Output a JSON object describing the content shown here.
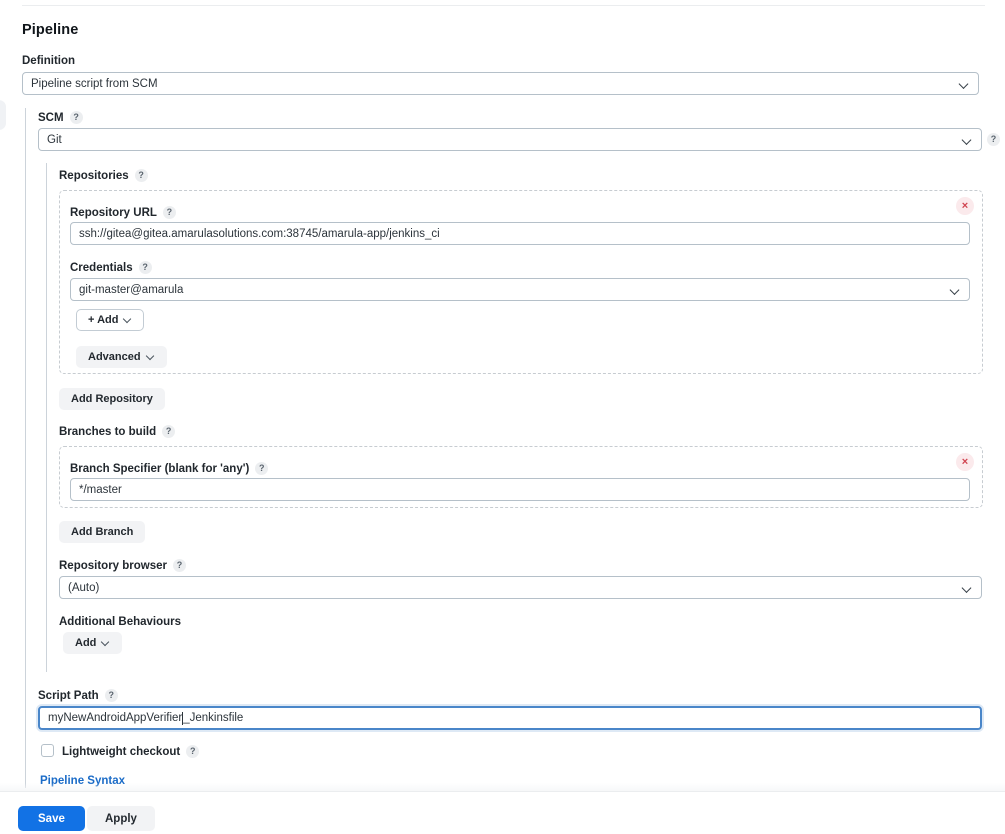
{
  "page": {
    "title": "Pipeline"
  },
  "definition": {
    "label": "Definition",
    "value": "Pipeline script from SCM",
    "chevron_icon": "chevron-down-icon"
  },
  "scm": {
    "label": "SCM",
    "help_icon": "?",
    "value": "Git",
    "chevron_icon": "chevron-down-icon",
    "side_help_icon": "?"
  },
  "repositories": {
    "label": "Repositories",
    "help_icon": "?",
    "delete_icon": "×",
    "repository_url": {
      "label": "Repository URL",
      "help_icon": "?",
      "value": "ssh://gitea@gitea.amarulasolutions.com:38745/amarula-app/jenkins_ci"
    },
    "credentials": {
      "label": "Credentials",
      "help_icon": "?",
      "value": "git-master@amarula",
      "chevron_icon": "chevron-down-icon"
    },
    "add_credentials_label": "+ Add",
    "advanced_label": "Advanced",
    "add_repository_label": "Add Repository"
  },
  "branches": {
    "label": "Branches to build",
    "help_icon": "?",
    "delete_icon": "×",
    "branch_specifier": {
      "label": "Branch Specifier (blank for 'any')",
      "help_icon": "?",
      "value": "*/master"
    },
    "add_branch_label": "Add Branch"
  },
  "repository_browser": {
    "label": "Repository browser",
    "help_icon": "?",
    "value": "(Auto)",
    "chevron_icon": "chevron-down-icon"
  },
  "additional_behaviours": {
    "label": "Additional Behaviours",
    "add_label": "Add"
  },
  "script_path": {
    "label": "Script Path",
    "help_icon": "?",
    "value_before_caret": "myNewAndroidAppVerifier",
    "value_after_caret": "_Jenkinsfile",
    "full_value": "myNewAndroidAppVerifier_Jenkinsfile",
    "focused": true
  },
  "lightweight_checkout": {
    "label": "Lightweight checkout",
    "help_icon": "?",
    "checked": false
  },
  "pipeline_syntax": {
    "label": "Pipeline Syntax"
  },
  "footer": {
    "save_label": "Save",
    "apply_label": "Apply"
  },
  "colors": {
    "primary": "#1272e5",
    "link": "#1a6bc7",
    "delete": "#d0434f",
    "border": "#b5c0c9",
    "dashed_border": "#c7ccd1"
  }
}
